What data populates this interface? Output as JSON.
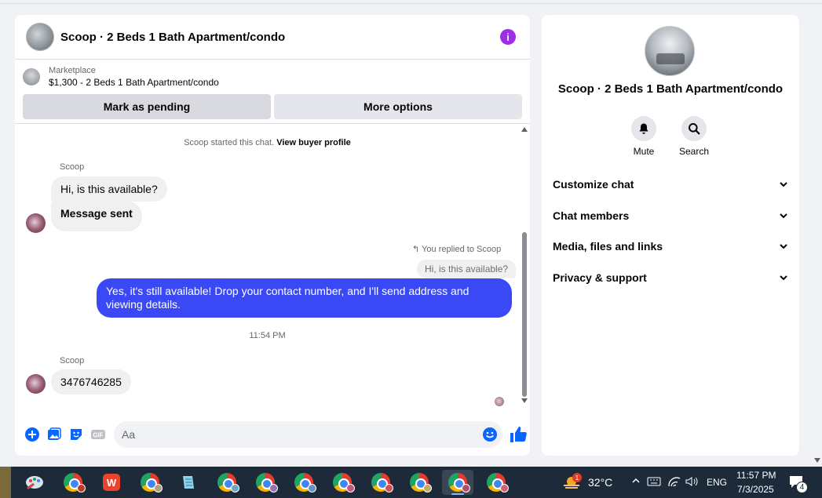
{
  "chat": {
    "title": "Scoop · 2 Beds 1 Bath Apartment/condo",
    "info_icon": "info-icon",
    "marketplace_label": "Marketplace",
    "listing": "$1,300 - 2 Beds 1 Bath Apartment/condo",
    "mark_pending": "Mark as pending",
    "more_options": "More options",
    "system_note_prefix": "Scoop started this chat.",
    "system_note_link": "View buyer profile",
    "messages": [
      {
        "sender": "Scoop",
        "text": "Hi, is this available?"
      },
      {
        "text": "Message sent"
      },
      {
        "replied_label": "You replied to Scoop",
        "quote": "Hi, is this available?",
        "text": "Yes, it's still available! Drop your contact number, and I'll send address and viewing details."
      },
      {
        "time": "11:54 PM"
      },
      {
        "sender": "Scoop",
        "text": "3476746285"
      }
    ],
    "composer_placeholder": "Aa"
  },
  "side": {
    "title": "Scoop · 2 Beds 1 Bath Apartment/condo",
    "actions": [
      "Mute",
      "Search"
    ],
    "sections": [
      "Customize chat",
      "Chat members",
      "Media, files and links",
      "Privacy & support"
    ]
  },
  "taskbar": {
    "weather": "32°C",
    "weather_badge": "1",
    "language": "ENG",
    "time": "11:57 PM",
    "date": "7/3/2025",
    "notifications": "4"
  },
  "colors": {
    "accent": "#3a49f5",
    "info": "#9b2ee6",
    "messenger_blue": "#0866ff"
  }
}
